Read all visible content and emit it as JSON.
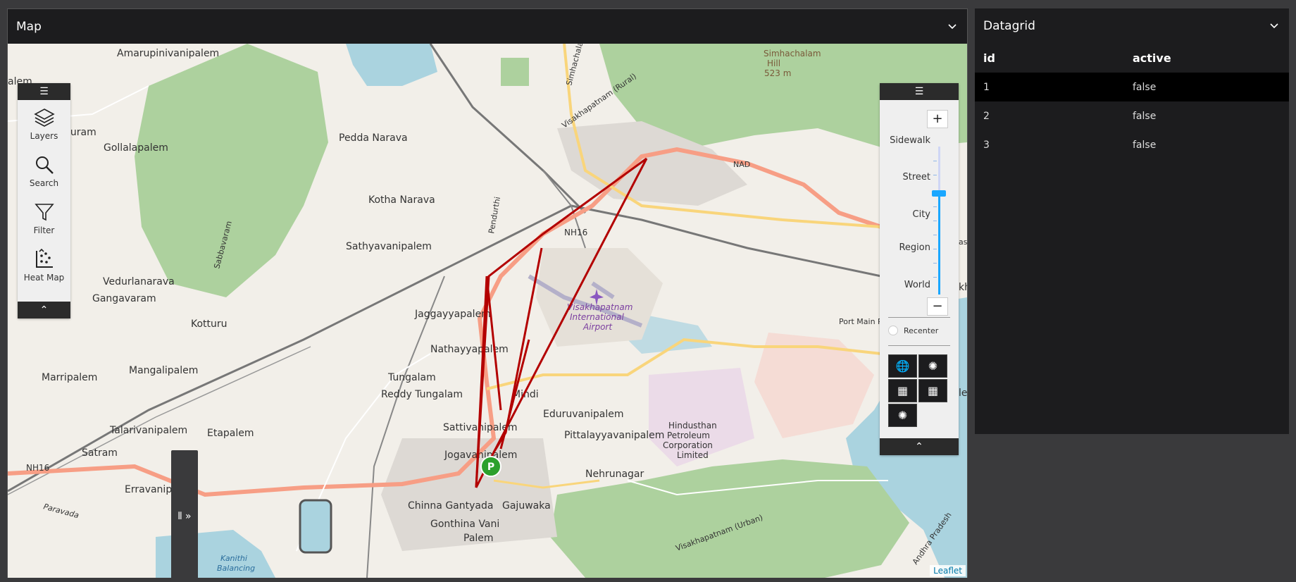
{
  "map_panel": {
    "title": "Map"
  },
  "grid_panel": {
    "title": "Datagrid"
  },
  "left_toolbar": {
    "items": [
      {
        "label": "Layers",
        "icon": "layers-icon"
      },
      {
        "label": "Search",
        "icon": "search-icon"
      },
      {
        "label": "Filter",
        "icon": "filter-icon"
      },
      {
        "label": "Heat Map",
        "icon": "heat-map-icon"
      }
    ]
  },
  "zoom_control": {
    "zoom_in": "+",
    "zoom_out": "−",
    "levels": [
      "Sidewalk",
      "Street",
      "City",
      "Region",
      "World"
    ],
    "current_level": "Street",
    "recenter_label": "Recenter"
  },
  "map_labels": {
    "places": [
      "Amarupinivanipalem",
      "Gollalapalem",
      "Pedda Narava",
      "Kotha Narava",
      "Sathyavanipalem",
      "Vedurlanarava",
      "Gangavaram",
      "Kotturu",
      "Jaggayyapalem",
      "Nathayyapalem",
      "Mangalipalem",
      "Marripalem",
      "Tungalam",
      "Reddy Tungalam",
      "Mindi",
      "Eduruvanipalem",
      "Sattivanipalem",
      "Pittalayyavanipalem",
      "Jogavanipalem",
      "Talarivanipalem",
      "Etapalem",
      "Satram",
      "Erravanip",
      "Nehrunagar",
      "Chinna Gantyada",
      "Gajuwaka",
      "Gonthina Vani",
      "Palem",
      "Simhachalam",
      "Hill",
      "523 m",
      "NAD",
      "NH16",
      "NH16",
      "Visakhapatnam",
      "International",
      "Airport",
      "Hindusthan",
      "Petroleum",
      "Corporation",
      "Limited",
      "Visakhapatnam (Rural)",
      "Visakhapatnam (Urban)",
      "Port Main Ro",
      "Paravada",
      "Kanithi",
      "Balancing",
      "Pendurthi",
      "Sabbavaram",
      "Simhachalam Road",
      "puram",
      "alem",
      "kh",
      "as",
      "le",
      "Andhra Pradesh"
    ]
  },
  "marker": {
    "label": "P",
    "color": "#2ca02c"
  },
  "attribution": "Leaflet",
  "datagrid": {
    "columns": [
      "id",
      "active"
    ],
    "rows": [
      {
        "id": "1",
        "active": "false"
      },
      {
        "id": "2",
        "active": "false"
      },
      {
        "id": "3",
        "active": "false"
      }
    ]
  },
  "colors": {
    "route": "#b30000",
    "header_bg": "#1c1c1e",
    "accent": "#1aa7ff"
  }
}
